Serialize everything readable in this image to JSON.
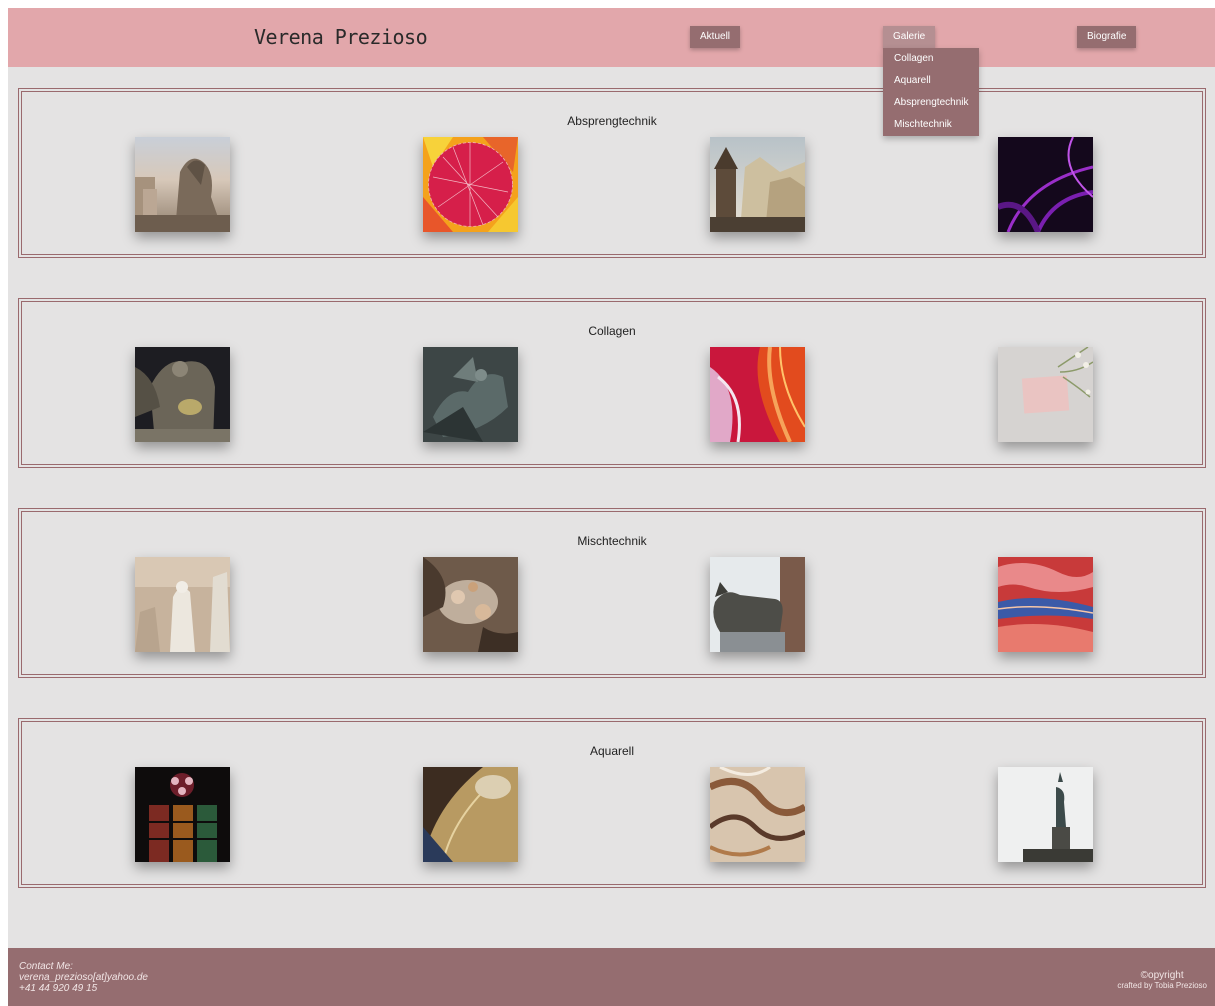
{
  "header": {
    "site_title": "Verena Prezioso",
    "nav": {
      "aktuell": "Aktuell",
      "galerie": "Galerie",
      "biografie": "Biografie"
    },
    "dropdown": [
      "Collagen",
      "Aquarell",
      "Absprengtechnik",
      "Mischtechnik"
    ]
  },
  "sections": [
    {
      "title": "Absprengtechnik",
      "images": [
        "gargoyle-photo",
        "red-mosaic-photo",
        "castle-cliff-photo",
        "purple-light-photo"
      ]
    },
    {
      "title": "Collagen",
      "images": [
        "angel-statue-photo",
        "bronze-relief-photo",
        "pink-agate-photo",
        "pink-card-flowers-photo"
      ]
    },
    {
      "title": "Mischtechnik",
      "images": [
        "marble-statues-photo",
        "baroque-ceiling-photo",
        "she-wolf-statue-photo",
        "red-agate-photo"
      ]
    },
    {
      "title": "Aquarell",
      "images": [
        "stained-glass-photo",
        "dome-interior-photo",
        "marble-swirl-photo",
        "statue-of-liberty-photo"
      ]
    }
  ],
  "footer": {
    "contact_label": "Contact Me:",
    "email": "verena_prezioso[at]yahoo.de",
    "phone": "+41 44 920 49 15",
    "copyright": "©opyright",
    "credit": "crafted by Tobia Prezioso"
  },
  "colors": {
    "header_bg": "#e2a7ab",
    "accent": "#956d70",
    "page_bg": "#e4e3e3",
    "border": "#9a6a6e"
  }
}
